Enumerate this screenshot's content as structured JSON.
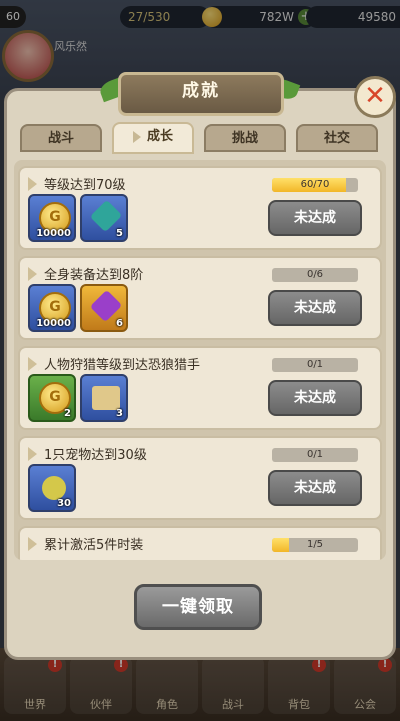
{
  "hud": {
    "level": "60",
    "stamina": "27/530",
    "gold": "782W",
    "gems": "49580",
    "player_name": "风乐然"
  },
  "dialog": {
    "title": "成就",
    "tabs": [
      {
        "label": "战斗",
        "active": false
      },
      {
        "label": "成长",
        "active": true
      },
      {
        "label": "挑战",
        "active": false
      },
      {
        "label": "社交",
        "active": false
      }
    ],
    "achievements": [
      {
        "title": "等级达到70级",
        "progress_text": "60/70",
        "progress_value": 0.857,
        "status": "未达成",
        "rewards": [
          {
            "icon": "gold-coin-icon",
            "qty": "10000",
            "color": "blue"
          },
          {
            "icon": "gem-icon",
            "qty": "5",
            "color": "blue"
          }
        ]
      },
      {
        "title": "全身装备达到8阶",
        "progress_text": "0/6",
        "progress_value": 0,
        "status": "未达成",
        "rewards": [
          {
            "icon": "gold-coin-icon",
            "qty": "10000",
            "color": "blue"
          },
          {
            "icon": "purple-gem-icon",
            "qty": "6",
            "color": "gold"
          }
        ]
      },
      {
        "title": "人物狩猎等级到达恐狼猎手",
        "progress_text": "0/1",
        "progress_value": 0,
        "status": "未达成",
        "rewards": [
          {
            "icon": "gold-coin-icon",
            "qty": "2",
            "color": "green"
          },
          {
            "icon": "map-scroll-icon",
            "qty": "3",
            "color": "blue"
          }
        ]
      },
      {
        "title": "1只宠物达到30级",
        "progress_text": "0/1",
        "progress_value": 0,
        "status": "未达成",
        "rewards": [
          {
            "icon": "fruit-icon",
            "qty": "30",
            "color": "blue"
          }
        ]
      },
      {
        "title": "累计激活5件时装",
        "progress_text": "1/5",
        "progress_value": 0.2,
        "status": "",
        "rewards": []
      }
    ],
    "claim_all_label": "一键领取"
  },
  "bottom_nav": [
    {
      "label": "世界"
    },
    {
      "label": "伙伴"
    },
    {
      "label": "角色"
    },
    {
      "label": "战斗"
    },
    {
      "label": "背包"
    },
    {
      "label": "公会"
    }
  ]
}
